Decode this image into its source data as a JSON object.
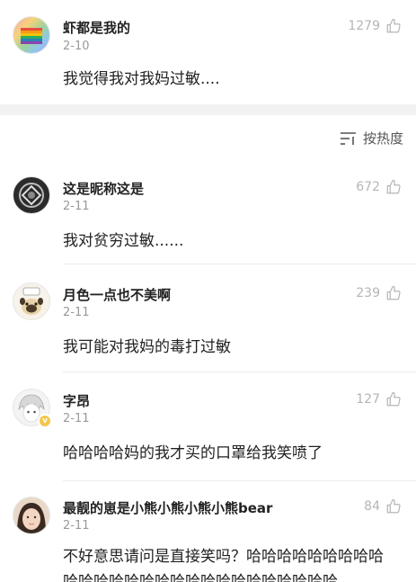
{
  "top_comment": {
    "name": "虾都是我的",
    "date": "2-10",
    "likes": "1279",
    "text": "我觉得我对我妈过敏...."
  },
  "sort_label": "按热度",
  "comments": [
    {
      "name": "这是昵称这是",
      "date": "2-11",
      "likes": "672",
      "text": "我对贫穷过敏......"
    },
    {
      "name": "月色一点也不美啊",
      "date": "2-11",
      "likes": "239",
      "text": "我可能对我妈的毒打过敏"
    },
    {
      "name": "字昂",
      "date": "2-11",
      "likes": "127",
      "text": "哈哈哈哈妈的我才买的口罩给我笑喷了",
      "verified": true
    },
    {
      "name": "最靓的崽是小熊小熊小熊小熊bear",
      "date": "2-11",
      "likes": "84",
      "text": "不好意思请问是直接笑吗？哈哈哈哈哈哈哈哈哈哈哈哈哈哈哈哈哈哈哈哈哈哈哈哈哈哈哈"
    }
  ],
  "colors": {
    "text": "#222222",
    "muted": "#999999",
    "likes": "#b5b5b5",
    "separator": "#f2f2f2"
  },
  "icons": {
    "like": "thumbs-up-icon",
    "sort": "sort-lines-icon"
  }
}
